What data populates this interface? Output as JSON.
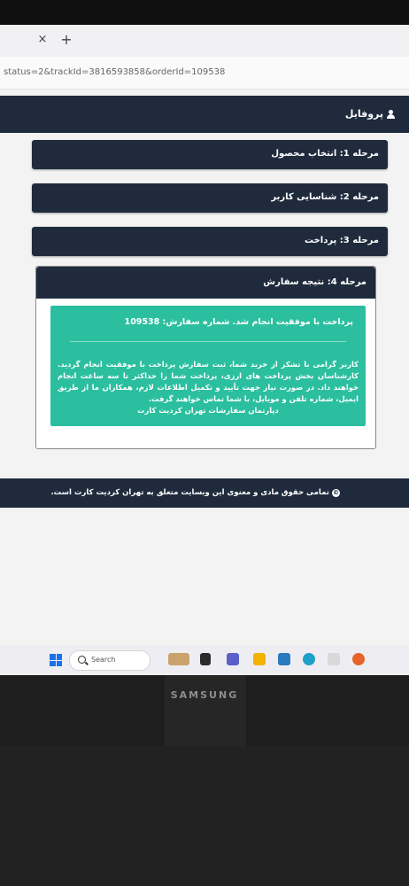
{
  "browser": {
    "close_glyph": "×",
    "new_tab_glyph": "+",
    "url": "status=2&trackId=3816593858&orderId=109538"
  },
  "header": {
    "profile_label": "پروفایل"
  },
  "steps": [
    {
      "label": "مرحله 1: انتخاب محصول"
    },
    {
      "label": "مرحله 2: شناسایی کاربر"
    },
    {
      "label": "مرحله 3: پرداخت"
    },
    {
      "label": "مرحله 4: نتیجه سفارش"
    }
  ],
  "result": {
    "title": "پرداخت با موفقیت انجام شد. شماره سفارش: 109538",
    "body": "کاربر گرامی با تشکر از خرید شما، ثبت سفارش پرداخت با موفقیت انجام گردید. کارشناسان بخش پرداخت های ارزی، پرداخت شما را حداکثر تا سه ساعت انجام خواهند داد. در صورت نیاز جهت تأیید و تکمیل اطلاعات لازم، همکاران ما از طریق ایمیل، شماره تلفن و موبایل، با شما تماس خواهند گرفت.",
    "signature": "دپارتمان سفارشات تهران کردیت کارت"
  },
  "footer": {
    "copyright": "تمامی حقوق مادی و معنوی این وبسایت متعلق به تهران کردیت کارت است."
  },
  "taskbar": {
    "search_placeholder": "Search"
  },
  "monitor": {
    "brand": "SAMSUNG"
  },
  "colors": {
    "navy": "#1f2b3d",
    "success": "#2bbf9f"
  }
}
